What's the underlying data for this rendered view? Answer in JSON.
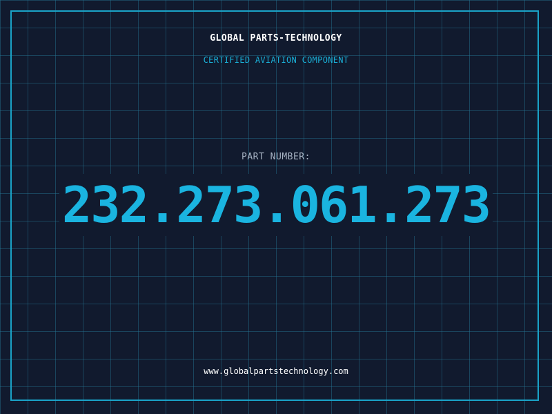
{
  "header": {
    "company": "GLOBAL PARTS-TECHNOLOGY",
    "tagline": "CERTIFIED AVIATION COMPONENT"
  },
  "part": {
    "label": "PART NUMBER:",
    "number": "232.273.061.273"
  },
  "footer": {
    "url": "www.globalpartstechnology.com"
  },
  "colors": {
    "background": "#111a2e",
    "grid": "#26789a",
    "accent": "#1ab4e0",
    "frame": "#1aa3c8"
  }
}
